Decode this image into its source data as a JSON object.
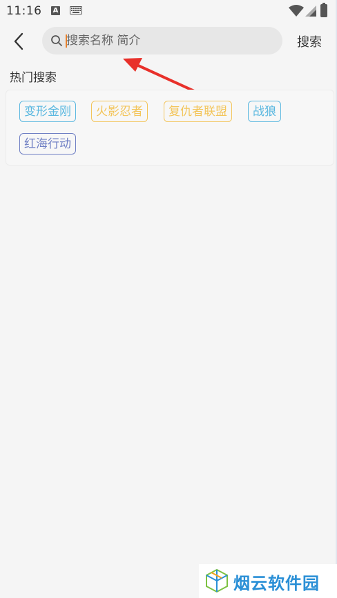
{
  "status_bar": {
    "time": "11:16",
    "notif_a": "A",
    "icons": [
      "a-notification-icon",
      "keyboard-icon",
      "wifi-icon",
      "signal-icon",
      "battery-icon"
    ]
  },
  "search": {
    "placeholder": "搜索名称 简介",
    "button_label": "搜索"
  },
  "hot": {
    "title": "热门搜索",
    "tags": [
      {
        "label": "变形金刚",
        "color": "#5bb8e0"
      },
      {
        "label": "火影忍者",
        "color": "#f3c55b"
      },
      {
        "label": "复仇者联盟",
        "color": "#f3c55b"
      },
      {
        "label": "战狼",
        "color": "#5bb8e0"
      },
      {
        "label": "红海行动",
        "color": "#6f7fc4"
      }
    ]
  },
  "annotation": {
    "arrow_color": "#e8302a"
  },
  "watermark": {
    "text": "烟云软件园"
  }
}
